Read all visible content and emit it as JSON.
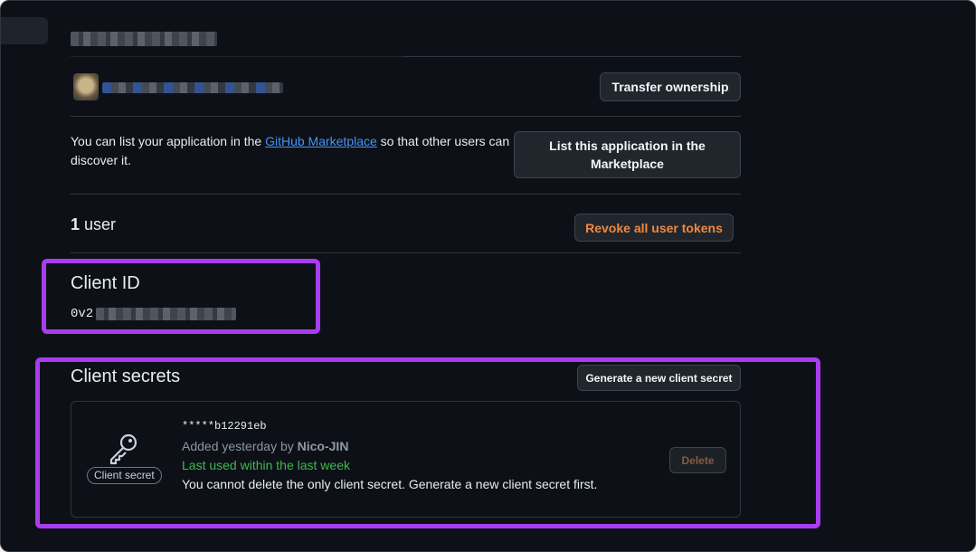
{
  "ownership": {
    "transfer_button": "Transfer ownership"
  },
  "marketplace": {
    "text_before": "You can list your application in the ",
    "link_text": "GitHub Marketplace",
    "text_after": " so that other users can",
    "text_line2": "discover it.",
    "list_button": "List this application in the Marketplace"
  },
  "users": {
    "count": "1",
    "label": " user",
    "revoke_button": "Revoke all user tokens"
  },
  "client_id": {
    "title": "Client ID",
    "value_prefix": "0v2"
  },
  "client_secrets": {
    "title": "Client secrets",
    "generate_button": "Generate a new client secret",
    "secret": {
      "masked_value": "*****b12291eb",
      "added_prefix": "Added yesterday by ",
      "added_by": "Nico-JIN",
      "last_used": "Last used within the last week",
      "warning": "You cannot delete the only client secret. Generate a new client secret first.",
      "badge": "Client secret",
      "delete_button": "Delete"
    }
  },
  "colors": {
    "background": "#0d1117",
    "highlight": "#a93cf0",
    "danger": "#f0883e",
    "success": "#3fb950",
    "link": "#4493f8"
  }
}
